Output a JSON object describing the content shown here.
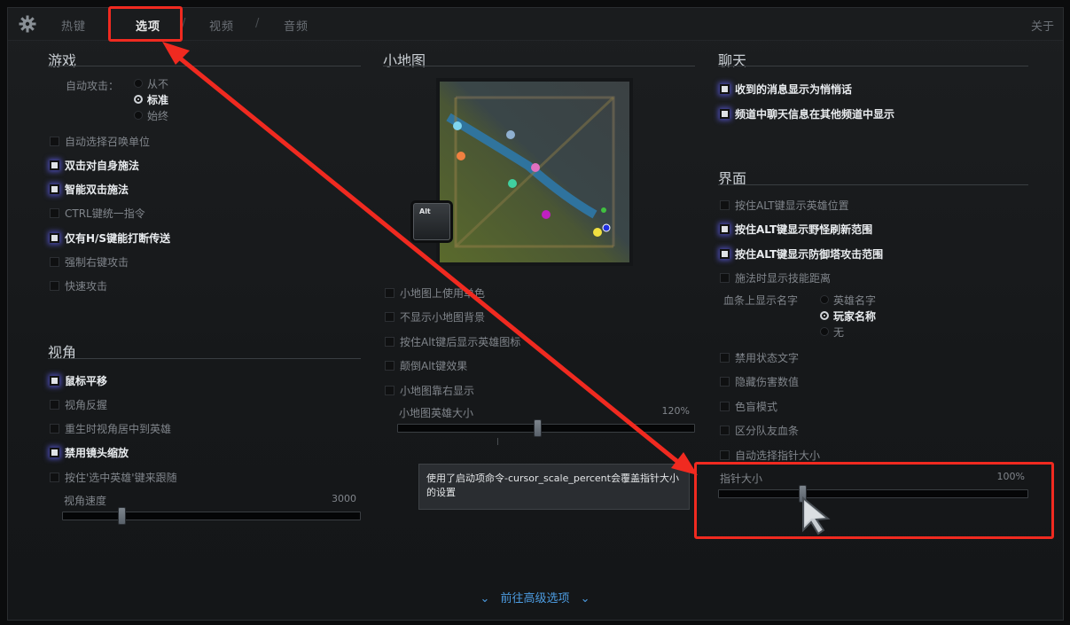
{
  "nav": {
    "tabs": [
      "热键",
      "选项",
      "/",
      "视频",
      "/",
      "音频"
    ],
    "about": "关于"
  },
  "game": {
    "title": "游戏",
    "autoattack_label": "自动攻击：",
    "autoattack_options": [
      "从不",
      "标准",
      "始终"
    ],
    "autoattack_selected": 1,
    "checkboxes": [
      {
        "label": "自动选择召唤单位",
        "checked": false
      },
      {
        "label": "双击对自身施法",
        "checked": true
      },
      {
        "label": "智能双击施法",
        "checked": true
      },
      {
        "label": "CTRL键统一指令",
        "checked": false
      },
      {
        "label": "仅有H/S键能打断传送",
        "checked": true
      },
      {
        "label": "强制右键攻击",
        "checked": false
      },
      {
        "label": "快速攻击",
        "checked": false
      }
    ]
  },
  "camera": {
    "title": "视角",
    "checkboxes": [
      {
        "label": "鼠标平移",
        "checked": true
      },
      {
        "label": "视角反握",
        "checked": false
      },
      {
        "label": "重生时视角居中到英雄",
        "checked": false
      },
      {
        "label": "禁用镜头缩放",
        "checked": true
      },
      {
        "label": "按住'选中英雄'键来跟随",
        "checked": false
      }
    ],
    "speed_label": "视角速度",
    "speed_value": "3000",
    "speed_fraction": 0.2
  },
  "minimap": {
    "title": "小地图",
    "alt_key": "Alt",
    "checkboxes": [
      {
        "label": "小地图上使用单色",
        "checked": false
      },
      {
        "label": "不显示小地图背景",
        "checked": false
      },
      {
        "label": "按住Alt键后显示英雄图标",
        "checked": false
      },
      {
        "label": "颠倒Alt键效果",
        "checked": false
      },
      {
        "label": "小地图靠右显示",
        "checked": false
      }
    ],
    "hero_size_label": "小地图英雄大小",
    "hero_size_value": "120%",
    "hero_size_fraction": 0.47
  },
  "chat": {
    "title": "聊天",
    "checkboxes": [
      {
        "label": "收到的消息显示为悄悄话",
        "checked": true
      },
      {
        "label": "频道中聊天信息在其他频道中显示",
        "checked": true
      }
    ]
  },
  "interface": {
    "title": "界面",
    "checkboxes_a": [
      {
        "label": "按住ALT键显示英雄位置",
        "checked": false
      },
      {
        "label": "按住ALT键显示野怪刷新范围",
        "checked": true
      },
      {
        "label": "按住ALT键显示防御塔攻击范围",
        "checked": true
      },
      {
        "label": "施法时显示技能距离",
        "checked": false
      }
    ],
    "healthbar_label": "血条上显示名字",
    "healthbar_options": [
      "英雄名字",
      "玩家名称",
      "无"
    ],
    "healthbar_selected": 1,
    "checkboxes_b": [
      {
        "label": "禁用状态文字",
        "checked": false
      },
      {
        "label": "隐藏伤害数值",
        "checked": false
      },
      {
        "label": "色盲模式",
        "checked": false
      },
      {
        "label": "区分队友血条",
        "checked": false
      },
      {
        "label": "自动选择指针大小",
        "checked": false
      }
    ],
    "cursor_size_label": "指针大小",
    "cursor_size_value": "100%",
    "cursor_size_fraction": 0.27
  },
  "tooltip": {
    "text": "使用了启动项命令-cursor_scale_percent会覆盖指针大小的设置"
  },
  "advanced_link": "前往高级选项",
  "colors": {
    "annotation": "#f02a20",
    "link": "#4c9be0",
    "check_glow": "#5a5adc"
  }
}
